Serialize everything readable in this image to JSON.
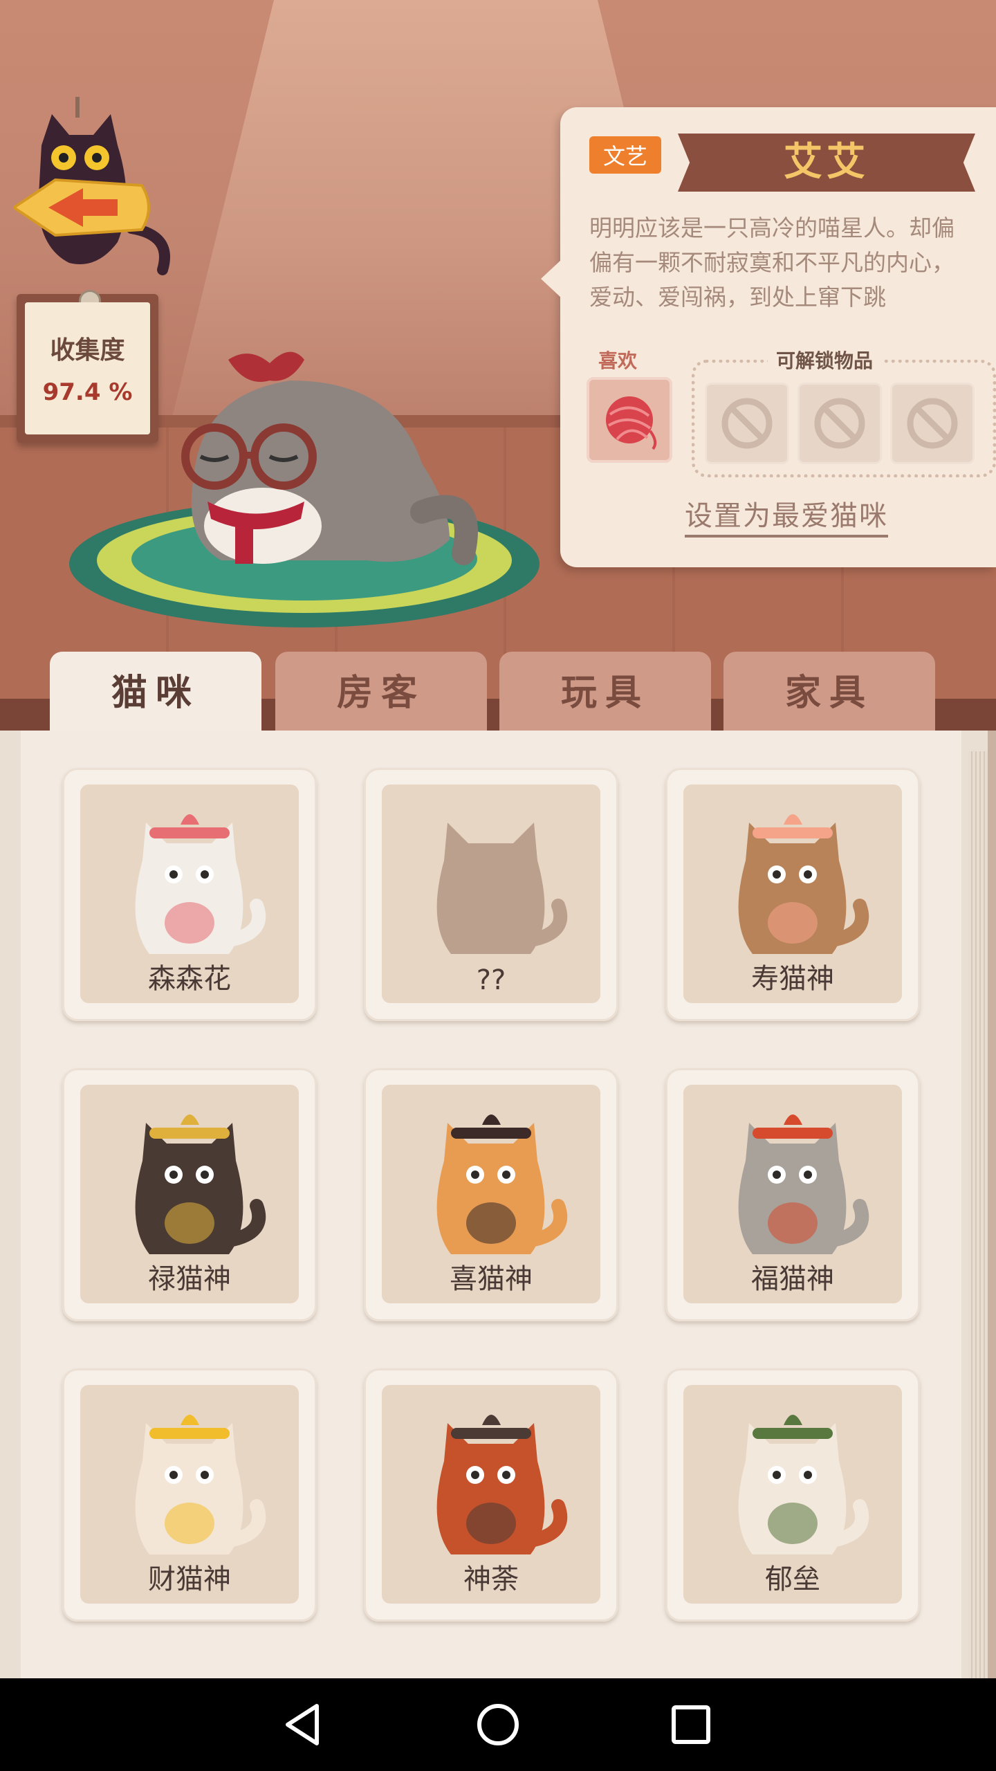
{
  "collection": {
    "title": "收集度",
    "value": "97.4 %"
  },
  "info": {
    "tag": "文艺",
    "name": "艾艾",
    "description": "明明应该是一只高冷的喵星人。却偏偏有一颗不耐寂寞和不平凡的内心，爱动、爱闯祸，到处上窜下跳",
    "likes_label": "喜欢",
    "likes": [
      {
        "icon": "yarn-ball-icon"
      }
    ],
    "unlock_label": "可解锁物品",
    "unlock_items": [
      {
        "icon": "locked-icon"
      },
      {
        "icon": "locked-icon"
      },
      {
        "icon": "locked-icon"
      }
    ],
    "set_favorite": "设置为最爱猫咪"
  },
  "tabs": [
    {
      "label": "猫咪",
      "active": true
    },
    {
      "label": "房客",
      "active": false
    },
    {
      "label": "玩具",
      "active": false
    },
    {
      "label": "家具",
      "active": false
    }
  ],
  "cats": [
    {
      "name": "森森花",
      "color": "#f2ede6",
      "accent": "#e76f74"
    },
    {
      "name": "??",
      "color": "#bba08e",
      "accent": "#bba08e"
    },
    {
      "name": "寿猫神",
      "color": "#b98359",
      "accent": "#f5a389"
    },
    {
      "name": "禄猫神",
      "color": "#4a3a34",
      "accent": "#e0b03d"
    },
    {
      "name": "喜猫神",
      "color": "#e79c52",
      "accent": "#3b2a27"
    },
    {
      "name": "福猫神",
      "color": "#a9a29a",
      "accent": "#d64b2d"
    },
    {
      "name": "财猫神",
      "color": "#f3e6d6",
      "accent": "#f2bd2d"
    },
    {
      "name": "神荼",
      "color": "#c5522b",
      "accent": "#4c3a34"
    },
    {
      "name": "郁垒",
      "color": "#f3e8dc",
      "accent": "#59783f"
    }
  ],
  "navbar": {
    "back": "back-nav-icon",
    "home": "home-nav-icon",
    "recents": "recents-nav-icon"
  }
}
